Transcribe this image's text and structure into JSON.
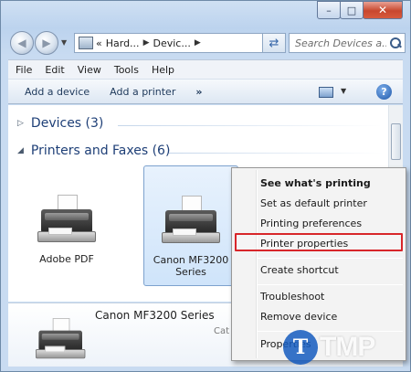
{
  "window": {
    "minimize_glyph": "–",
    "maximize_glyph": "□",
    "close_glyph": "✕"
  },
  "address": {
    "prefix": "«",
    "crumbs": [
      "Hard...",
      "Devic..."
    ],
    "search_placeholder": "Search Devices a..."
  },
  "menubar": {
    "items": [
      "File",
      "Edit",
      "View",
      "Tools",
      "Help"
    ]
  },
  "cmdbar": {
    "add_device": "Add a device",
    "add_printer": "Add a printer",
    "more": "»",
    "help": "?"
  },
  "groups": {
    "devices": "Devices (3)",
    "printers": "Printers and Faxes (6)"
  },
  "tiles": [
    {
      "label": "Adobe PDF"
    },
    {
      "label_line1": "Canon MF3200",
      "label_line2": "Series"
    }
  ],
  "details": {
    "name": "Canon MF3200 Series",
    "category": "Cat"
  },
  "context_menu": {
    "items": [
      "See what's printing",
      "Set as default printer",
      "Printing preferences",
      "Printer properties",
      "Create shortcut",
      "Troubleshoot",
      "Remove device",
      "Properties"
    ]
  },
  "watermark": {
    "letter": "T",
    "text": "TMP"
  },
  "colors": {
    "highlight_border": "#d8262a",
    "group_title": "#1e3f77",
    "watermark_circle": "#145abe"
  }
}
